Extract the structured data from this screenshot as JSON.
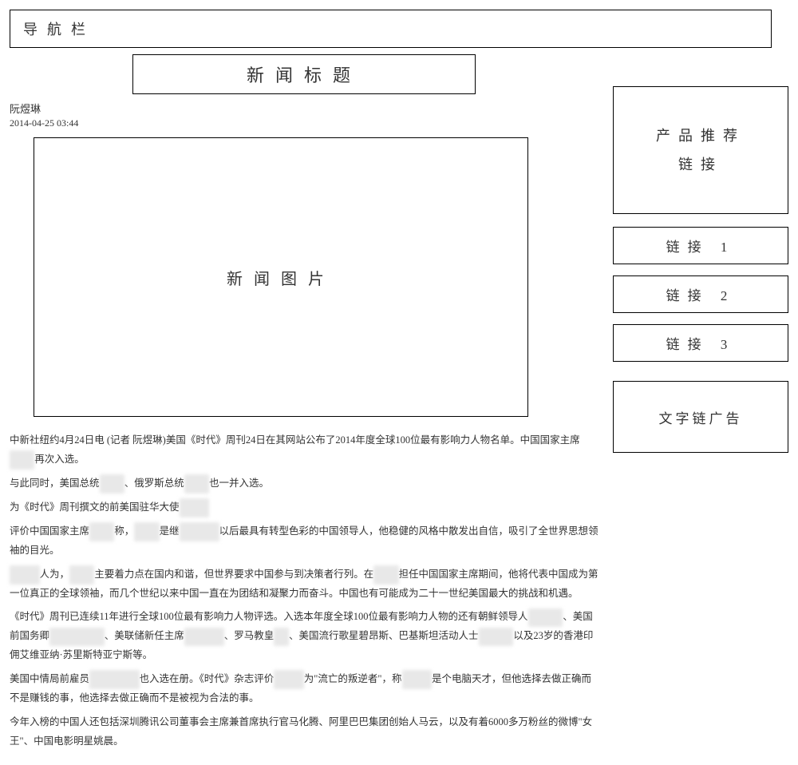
{
  "nav": {
    "label": "导航栏"
  },
  "header": {
    "title": "新闻标题",
    "author": "阮煜琳",
    "timestamp": "2014-04-25 03:44"
  },
  "image": {
    "placeholder": "新闻图片"
  },
  "article": {
    "p1a": "中新社纽约4月24日电 (记者 阮煜琳)美国《时代》周刊24日在其网站公布了2014年度全球100位最有影响力人物名单。中国国家主席",
    "p1b": "再次入选。",
    "p2a": "与此同时，美国总统",
    "p2b": "、俄罗斯总统",
    "p2c": "也一并入选。",
    "p3a": "为《时代》周刊撰文的前美国驻华大使",
    "p4a": "评价中国国家主席",
    "p4b": "称，",
    "p4c": "是继",
    "p4d": "以后最具有转型色彩的中国领导人，他稳健的风格中散发出自信，吸引了全世界思想领袖的目光。",
    "p5a": "人为，",
    "p5b": "主要着力点在国内和谐，但世界要求中国参与到决策者行列。在",
    "p5c": "担任中国国家主席期间，他将代表中国成为第一位真正的全球领袖，而几个世纪以来中国一直在为团结和凝聚力而奋斗。中国也有可能成为二十一世纪美国最大的挑战和机遇。",
    "p6a": "《时代》周刊已连续11年进行全球100位最有影响力人物评选。入选本年度全球100位最有影响力人物的还有朝鲜领导人",
    "p6b": "、美国前国务卿",
    "p6c": "、美联储新任主席",
    "p6d": "、罗马教皇",
    "p6e": "、美国流行歌星碧昂斯、巴基斯坦活动人士",
    "p6f": "以及23岁的香港印佣艾维亚纳·苏里斯特亚宁斯等。",
    "p7a": "美国中情局前雇员",
    "p7b": "也入选在册。《时代》杂志评价",
    "p7c": "为\"流亡的叛逆者\"，称",
    "p7d": "是个电脑天才，但他选择去做正确而不是赚钱的事，他选择去做正确而不是被视为合法的事。",
    "p8": "今年入榜的中国人还包括深圳腾讯公司董事会主席兼首席执行官马化腾、阿里巴巴集团创始人马云，以及有着6000多万粉丝的微博\"女王\"、中国电影明星姚晨。"
  },
  "sidebar": {
    "promo_line1": "产品推荐",
    "promo_line2": "链接",
    "link1": "链接 1",
    "link2": "链接 2",
    "link3": "链接 3",
    "ad": "文字链广告"
  }
}
